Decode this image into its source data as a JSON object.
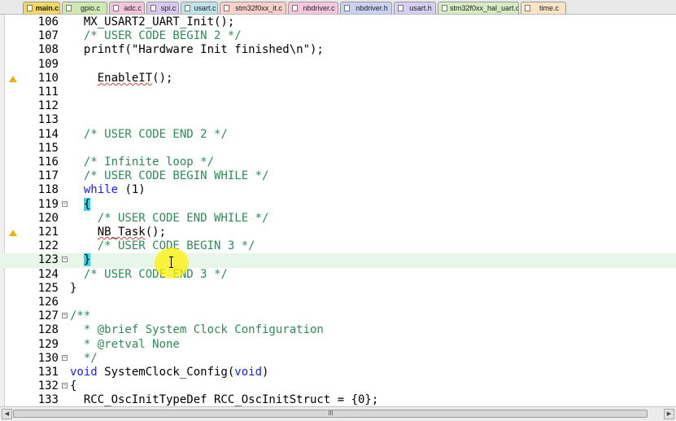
{
  "tabs": [
    {
      "label": "main.c",
      "active": true,
      "color": "#f2d95c"
    },
    {
      "label": "gpio.c",
      "active": false,
      "color": "#cde8b0"
    },
    {
      "label": "adc.c",
      "active": false,
      "color": "#f3c5d8"
    },
    {
      "label": "spi.c",
      "active": false,
      "color": "#d7c7ef"
    },
    {
      "label": "usart.c",
      "active": false,
      "color": "#bfe3ea"
    },
    {
      "label": "stm32f0xx_it.c",
      "active": false,
      "color": "#f8d0c8"
    },
    {
      "label": "nbdriver.c",
      "active": false,
      "color": "#f4c6e0"
    },
    {
      "label": "nbdriver.h",
      "active": false,
      "color": "#c9d3f1"
    },
    {
      "label": "usart.h",
      "active": false,
      "color": "#d6cff2"
    },
    {
      "label": "stm32f0xx_hal_uart.c",
      "active": false,
      "color": "#d8ecc4"
    },
    {
      "label": "time.c",
      "active": false,
      "color": "#fbe3c6"
    }
  ],
  "editor": {
    "lines": [
      {
        "n": "106",
        "code": "  MX_USART2_UART_Init();"
      },
      {
        "n": "107",
        "code": "  /* USER CODE BEGIN 2 */"
      },
      {
        "n": "108",
        "code": "  printf(\"Hardware Init finished\\n\");"
      },
      {
        "n": "109",
        "code": ""
      },
      {
        "n": "110",
        "code": "    EnableIT();"
      },
      {
        "n": "111",
        "code": ""
      },
      {
        "n": "112",
        "code": ""
      },
      {
        "n": "113",
        "code": ""
      },
      {
        "n": "114",
        "code": "  /* USER CODE END 2 */"
      },
      {
        "n": "115",
        "code": ""
      },
      {
        "n": "116",
        "code": "  /* Infinite loop */"
      },
      {
        "n": "117",
        "code": "  /* USER CODE BEGIN WHILE */"
      },
      {
        "n": "118",
        "code": "  while (1)"
      },
      {
        "n": "119",
        "code": "  {"
      },
      {
        "n": "120",
        "code": "    /* USER CODE END WHILE */"
      },
      {
        "n": "121",
        "code": "    NB_Task();"
      },
      {
        "n": "122",
        "code": "    /* USER CODE BEGIN 3 */"
      },
      {
        "n": "123",
        "code": "  }"
      },
      {
        "n": "124",
        "code": "  /* USER CODE END 3 */"
      },
      {
        "n": "125",
        "code": "}"
      },
      {
        "n": "126",
        "code": ""
      },
      {
        "n": "127",
        "code": "/**"
      },
      {
        "n": "128",
        "code": "  * @brief System Clock Configuration"
      },
      {
        "n": "129",
        "code": "  * @retval None"
      },
      {
        "n": "130",
        "code": "  */"
      },
      {
        "n": "131",
        "code": "void SystemClock_Config(void)"
      },
      {
        "n": "132",
        "code": "{"
      },
      {
        "n": "133",
        "code": "  RCC_OscInitTypeDef RCC_OscInitStruct = {0};"
      }
    ],
    "current_line": "123",
    "warning_lines": [
      "110",
      "121"
    ],
    "fold_markers": {
      "119": "−",
      "123": "−",
      "127": "−",
      "130": "−",
      "132": "−"
    }
  },
  "colors": {
    "comment": "#2e8b57",
    "keyword": "#1a1aff",
    "current_line": "#e8f6ea",
    "brace_match": "#33d6e6",
    "cursor_highlight": "#fff000"
  },
  "icons": {
    "warning": "warning-icon",
    "fold": "fold-toggle-icon",
    "ibeam": "ibeam-cursor-icon"
  }
}
